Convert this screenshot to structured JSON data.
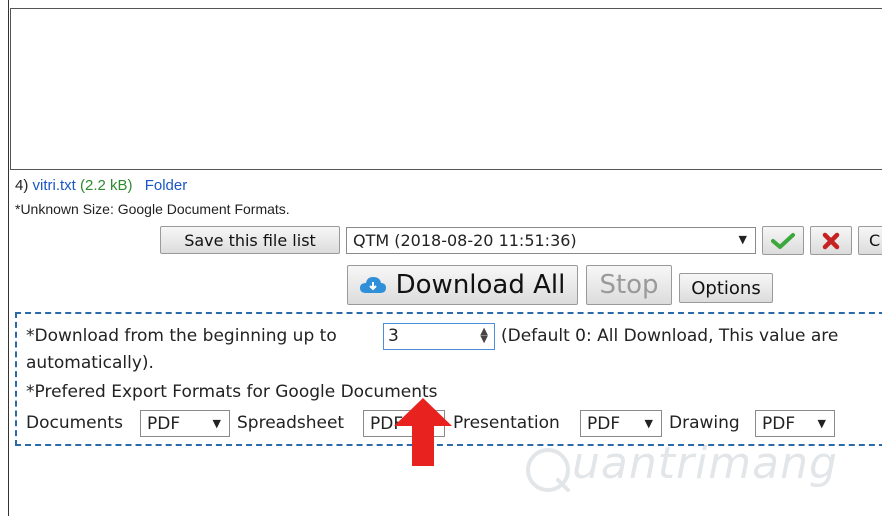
{
  "file_entry": {
    "index": "4)",
    "name": "vitri.txt",
    "size": "(2.2 kB)",
    "folder_link": "Folder"
  },
  "note": "*Unknown Size: Google Document Formats.",
  "toolbar": {
    "save_label": "Save this file list",
    "list_select_value": "QTM (2018-08-20 11:51:36)",
    "c_label": "C"
  },
  "actions": {
    "download_all": "Download All",
    "stop": "Stop",
    "options": "Options"
  },
  "settings": {
    "download_label": "*Download from the beginning up to",
    "download_value": "3",
    "download_hint": "(Default 0: All Download, This value are",
    "download_hint_cont": "automatically).",
    "export_title": "*Prefered Export Formats for Google Documents",
    "formats": [
      {
        "label": "Documents",
        "value": "PDF"
      },
      {
        "label": "Spreadsheet",
        "value": "PDF"
      },
      {
        "label": "Presentation",
        "value": "PDF"
      },
      {
        "label": "Drawing",
        "value": "PDF"
      }
    ]
  },
  "colors": {
    "link": "#1a56c8",
    "size_text": "#2e8b2e",
    "dashed_border": "#2a6aa8",
    "arrow": "#e8231f",
    "check": "#3aa83a",
    "cross": "#c62222"
  },
  "watermark": "uantrimang"
}
